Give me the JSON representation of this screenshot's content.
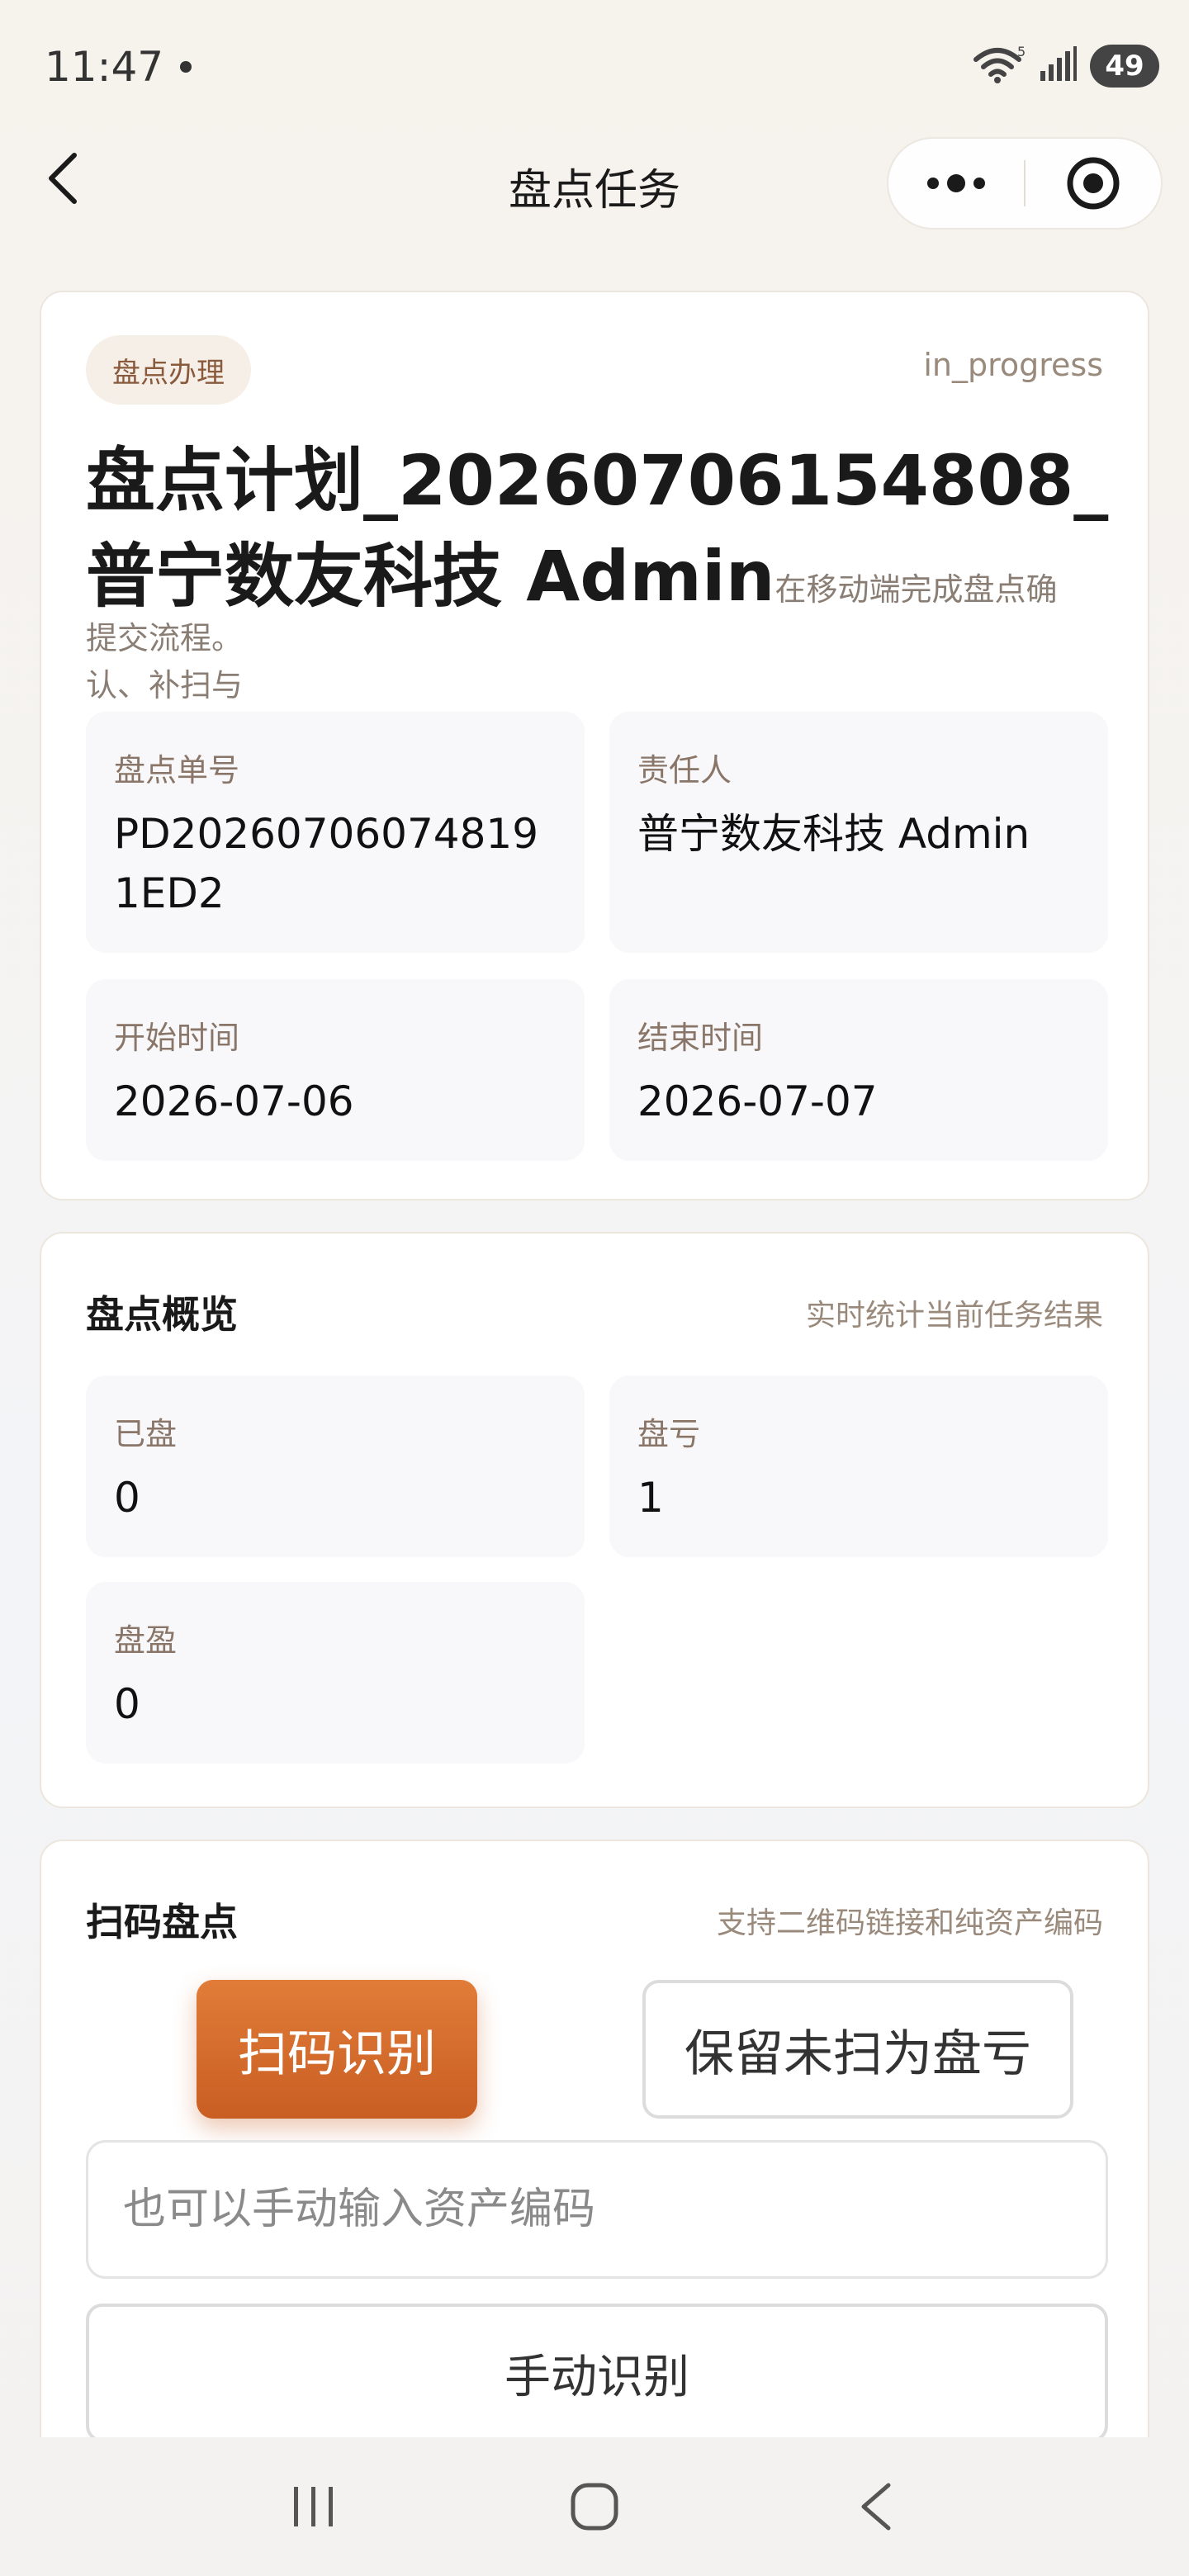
{
  "status_bar": {
    "time": "11:47",
    "battery": "49"
  },
  "nav": {
    "title": "盘点任务"
  },
  "task": {
    "tag": "盘点办理",
    "status": "in_progress",
    "title": "盘点计划_20260706154808_普宁数友科技 Admin",
    "desc_inline": "在移动端完成盘点确认、补扫与",
    "desc_rest": "提交流程。",
    "fields": {
      "order_no_label": "盘点单号",
      "order_no": "PD202607060748191ED2",
      "owner_label": "责任人",
      "owner": "普宁数友科技 Admin",
      "start_label": "开始时间",
      "start": "2026-07-06",
      "end_label": "结束时间",
      "end": "2026-07-07"
    }
  },
  "overview": {
    "title": "盘点概览",
    "hint": "实时统计当前任务结果",
    "counted_label": "已盘",
    "counted": "0",
    "loss_label": "盘亏",
    "loss": "1",
    "gain_label": "盘盈",
    "gain": "0"
  },
  "scan": {
    "title": "扫码盘点",
    "hint": "支持二维码链接和纯资产编码",
    "scan_button": "扫码识别",
    "keep_button": "保留未扫为盘亏",
    "input_placeholder": "也可以手动输入资产编码",
    "manual_button": "手动识别"
  },
  "colors": {
    "accent": "#d56a2c",
    "tag_bg": "#f6efe8",
    "tile_bg": "#f8f8fa"
  }
}
